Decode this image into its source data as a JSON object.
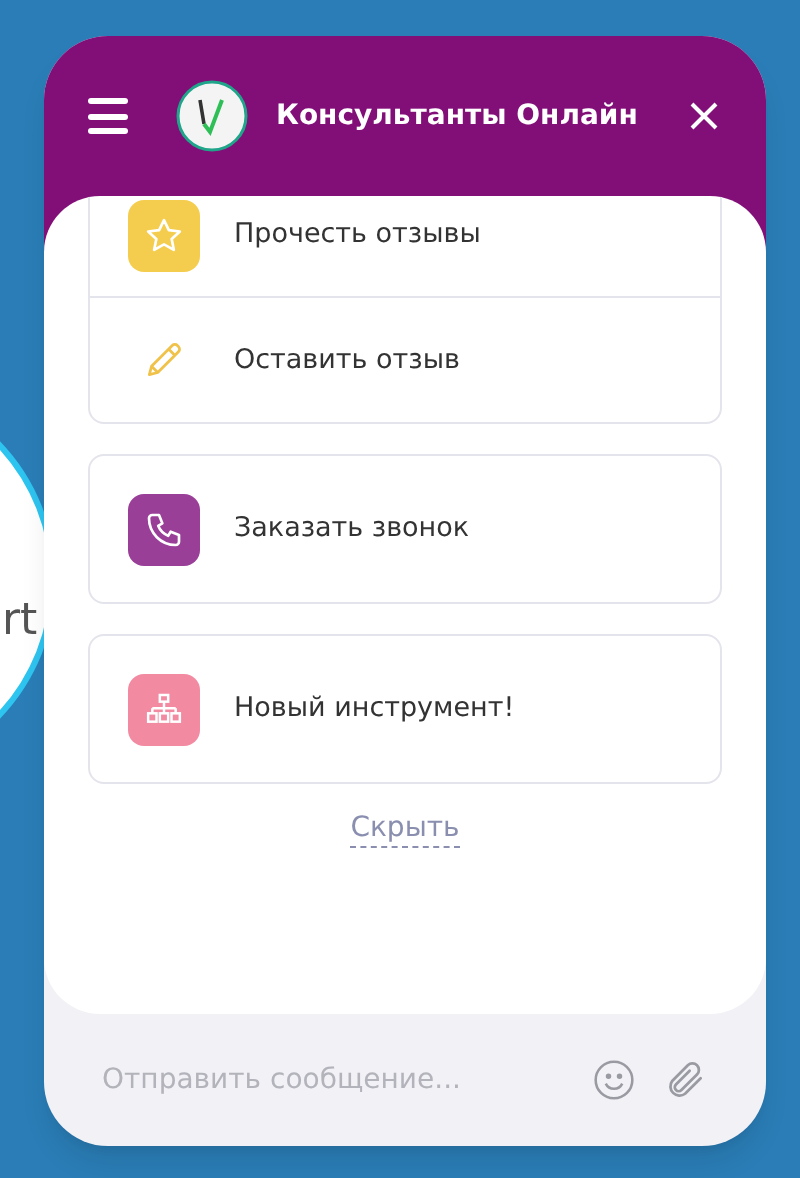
{
  "background": {
    "text": "rt"
  },
  "header": {
    "title": "Консультанты Онлайн"
  },
  "menu": [
    {
      "items": [
        {
          "label": "Прочесть отзывы",
          "kind": "star",
          "color": "#f5cd4e"
        },
        {
          "label": "Оставить отзыв",
          "kind": "pencil"
        }
      ]
    },
    {
      "items": [
        {
          "label": "Заказать звонок",
          "kind": "phone",
          "color": "#9a3f98"
        }
      ]
    },
    {
      "items": [
        {
          "label": "Новый инструмент!",
          "kind": "network",
          "color": "#f28aa2"
        }
      ]
    }
  ],
  "hide_link": "Скрыть",
  "composer": {
    "placeholder": "Отправить сообщение..."
  }
}
